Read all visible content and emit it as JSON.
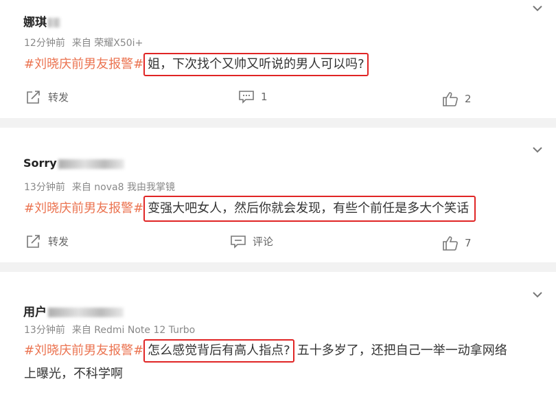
{
  "comments": [
    {
      "username": "娜琪",
      "time": "12分钟前",
      "source": "来自 荣耀X50i+",
      "hashtag": "#刘晓庆前男友报警#",
      "highlighted_text": "姐，下次找个又帅又听说的男人可以吗?",
      "trailing_text": "",
      "continuation_text": "",
      "repost_label": "转发",
      "comment_count": "1",
      "like_count": "2"
    },
    {
      "username": "Sorry",
      "time": "13分钟前",
      "source": "来自 nova8 我由我掌镜",
      "hashtag": "#刘晓庆前男友报警#",
      "highlighted_text": "变强大吧女人，然后你就会发现，有些个前任是多大个笑话",
      "trailing_text": "",
      "continuation_text": "",
      "repost_label": "转发",
      "comment_count": "评论",
      "like_count": "7"
    },
    {
      "username": "用户",
      "time": "13分钟前",
      "source": "来自 Redmi Note 12 Turbo",
      "hashtag": "#刘晓庆前男友报警#",
      "highlighted_text": "怎么感觉背后有高人指点?",
      "trailing_text": "五十多岁了，还把自己一举一动拿网络",
      "continuation_text": "上曝光，不科学啊",
      "repost_label": "",
      "comment_count": "",
      "like_count": ""
    }
  ],
  "colors": {
    "hashtag": "#eb7350",
    "highlight_border": "#e02424",
    "divider": "#f2f2f2",
    "meta": "#888888"
  }
}
